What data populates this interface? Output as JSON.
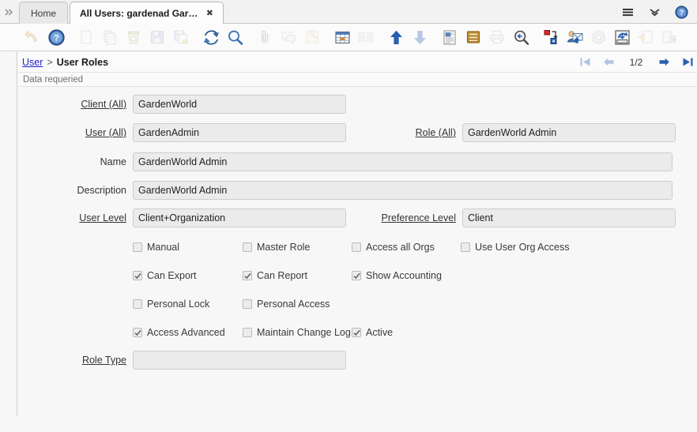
{
  "window": {
    "collapse_icon": "chevron-double-right-icon",
    "tabs": [
      {
        "label": "Home",
        "active": false,
        "closable": false
      },
      {
        "label": "All Users: gardenad Garden...",
        "active": true,
        "closable": true,
        "close_glyph": "✖"
      }
    ],
    "top_right_icons": [
      {
        "name": "menu-hamburger-icon"
      },
      {
        "name": "chevron-double-down-icon"
      },
      {
        "name": "help-icon"
      }
    ]
  },
  "toolbar": {
    "buttons": [
      {
        "name": "undo-button",
        "icon": "undo-arrow-icon",
        "enabled": false
      },
      {
        "name": "help-button",
        "icon": "help-icon",
        "enabled": true
      },
      {
        "name": "new-record-button",
        "icon": "new-document-icon",
        "enabled": false
      },
      {
        "name": "copy-record-button",
        "icon": "copy-document-icon",
        "enabled": false
      },
      {
        "name": "delete-record-button",
        "icon": "trash-icon",
        "enabled": false
      },
      {
        "name": "save-record-button",
        "icon": "floppy-save-icon",
        "enabled": false
      },
      {
        "name": "save-create-button",
        "icon": "save-new-icon",
        "enabled": false
      },
      {
        "name": "refresh-button",
        "icon": "refresh-arrows-icon",
        "enabled": true
      },
      {
        "name": "find-button",
        "icon": "magnifier-icon",
        "enabled": true
      },
      {
        "name": "attachment-button",
        "icon": "paperclip-icon",
        "enabled": false
      },
      {
        "name": "chat-button",
        "icon": "chat-bubbles-icon",
        "enabled": false
      },
      {
        "name": "post-it-button",
        "icon": "postit-note-icon",
        "enabled": false
      },
      {
        "name": "grid-toggle-button",
        "icon": "grid-table-icon",
        "enabled": true
      },
      {
        "name": "multi-form-button",
        "icon": "two-panes-icon",
        "enabled": false
      },
      {
        "name": "parent-record-button",
        "icon": "arrow-up-icon",
        "enabled": true
      },
      {
        "name": "detail-record-button",
        "icon": "arrow-down-icon",
        "enabled": false
      },
      {
        "name": "report-button",
        "icon": "report-document-icon",
        "enabled": true
      },
      {
        "name": "archive-button",
        "icon": "archive-drawer-icon",
        "enabled": true
      },
      {
        "name": "print-button",
        "icon": "printer-icon",
        "enabled": false
      },
      {
        "name": "zoom-across-button",
        "icon": "magnifier-back-icon",
        "enabled": true
      },
      {
        "name": "active-workflow-button",
        "icon": "workflow-nodes-icon",
        "enabled": true
      },
      {
        "name": "request-button",
        "icon": "mail-user-icon",
        "enabled": true
      },
      {
        "name": "preference-button",
        "icon": "gear-icon",
        "enabled": false
      },
      {
        "name": "export-button",
        "icon": "export-drawer-icon",
        "enabled": true
      },
      {
        "name": "history-button",
        "icon": "history-document-icon",
        "enabled": false
      },
      {
        "name": "exit-button",
        "icon": "exit-window-icon",
        "enabled": false
      }
    ]
  },
  "breadcrumb": {
    "parent": "User",
    "separator": ">",
    "current": "User Roles"
  },
  "record_nav": {
    "first_label": "first-record",
    "previous_label": "previous-record",
    "page_indicator": "1/2",
    "next_label": "next-record",
    "last_label": "last-record"
  },
  "status": {
    "message": "Data requeried"
  },
  "form": {
    "fields": [
      {
        "label": "Client (All)",
        "value": "GardenWorld",
        "link": true,
        "col": "left"
      },
      {
        "label": "User (All)",
        "value": "GardenAdmin",
        "link": true,
        "col": "left"
      },
      {
        "label": "Role (All)",
        "value": "GardenWorld Admin",
        "link": true,
        "col": "right"
      },
      {
        "label": "Name",
        "value": "GardenWorld Admin",
        "link": false,
        "col": "full"
      },
      {
        "label": "Description",
        "value": "GardenWorld Admin",
        "link": false,
        "col": "full"
      },
      {
        "label": "User Level",
        "value": "Client+Organization",
        "link": true,
        "col": "left"
      },
      {
        "label": "Preference Level",
        "value": "Client",
        "link": true,
        "col": "right"
      },
      {
        "label": "Role Type",
        "value": "",
        "link": true,
        "col": "left"
      }
    ],
    "checkbox_rows": [
      [
        {
          "label": "Manual",
          "checked": false
        },
        {
          "label": "Master Role",
          "checked": false
        },
        {
          "label": "Access all Orgs",
          "checked": false
        },
        {
          "label": "Use User Org Access",
          "checked": false
        }
      ],
      [
        {
          "label": "Can Export",
          "checked": true
        },
        {
          "label": "Can Report",
          "checked": true
        },
        {
          "label": "Show Accounting",
          "checked": true
        }
      ],
      [
        {
          "label": "Personal Lock",
          "checked": false
        },
        {
          "label": "Personal Access",
          "checked": false
        }
      ],
      [
        {
          "label": "Access Advanced",
          "checked": true
        },
        {
          "label": "Maintain Change Log",
          "checked": false
        },
        {
          "label": "Active",
          "checked": true
        }
      ]
    ]
  },
  "colors": {
    "accent_blue": "#2a5fb0",
    "link_blue": "#2222cc",
    "field_bg": "#ebebeb",
    "page_bg": "#f7f7f7"
  }
}
